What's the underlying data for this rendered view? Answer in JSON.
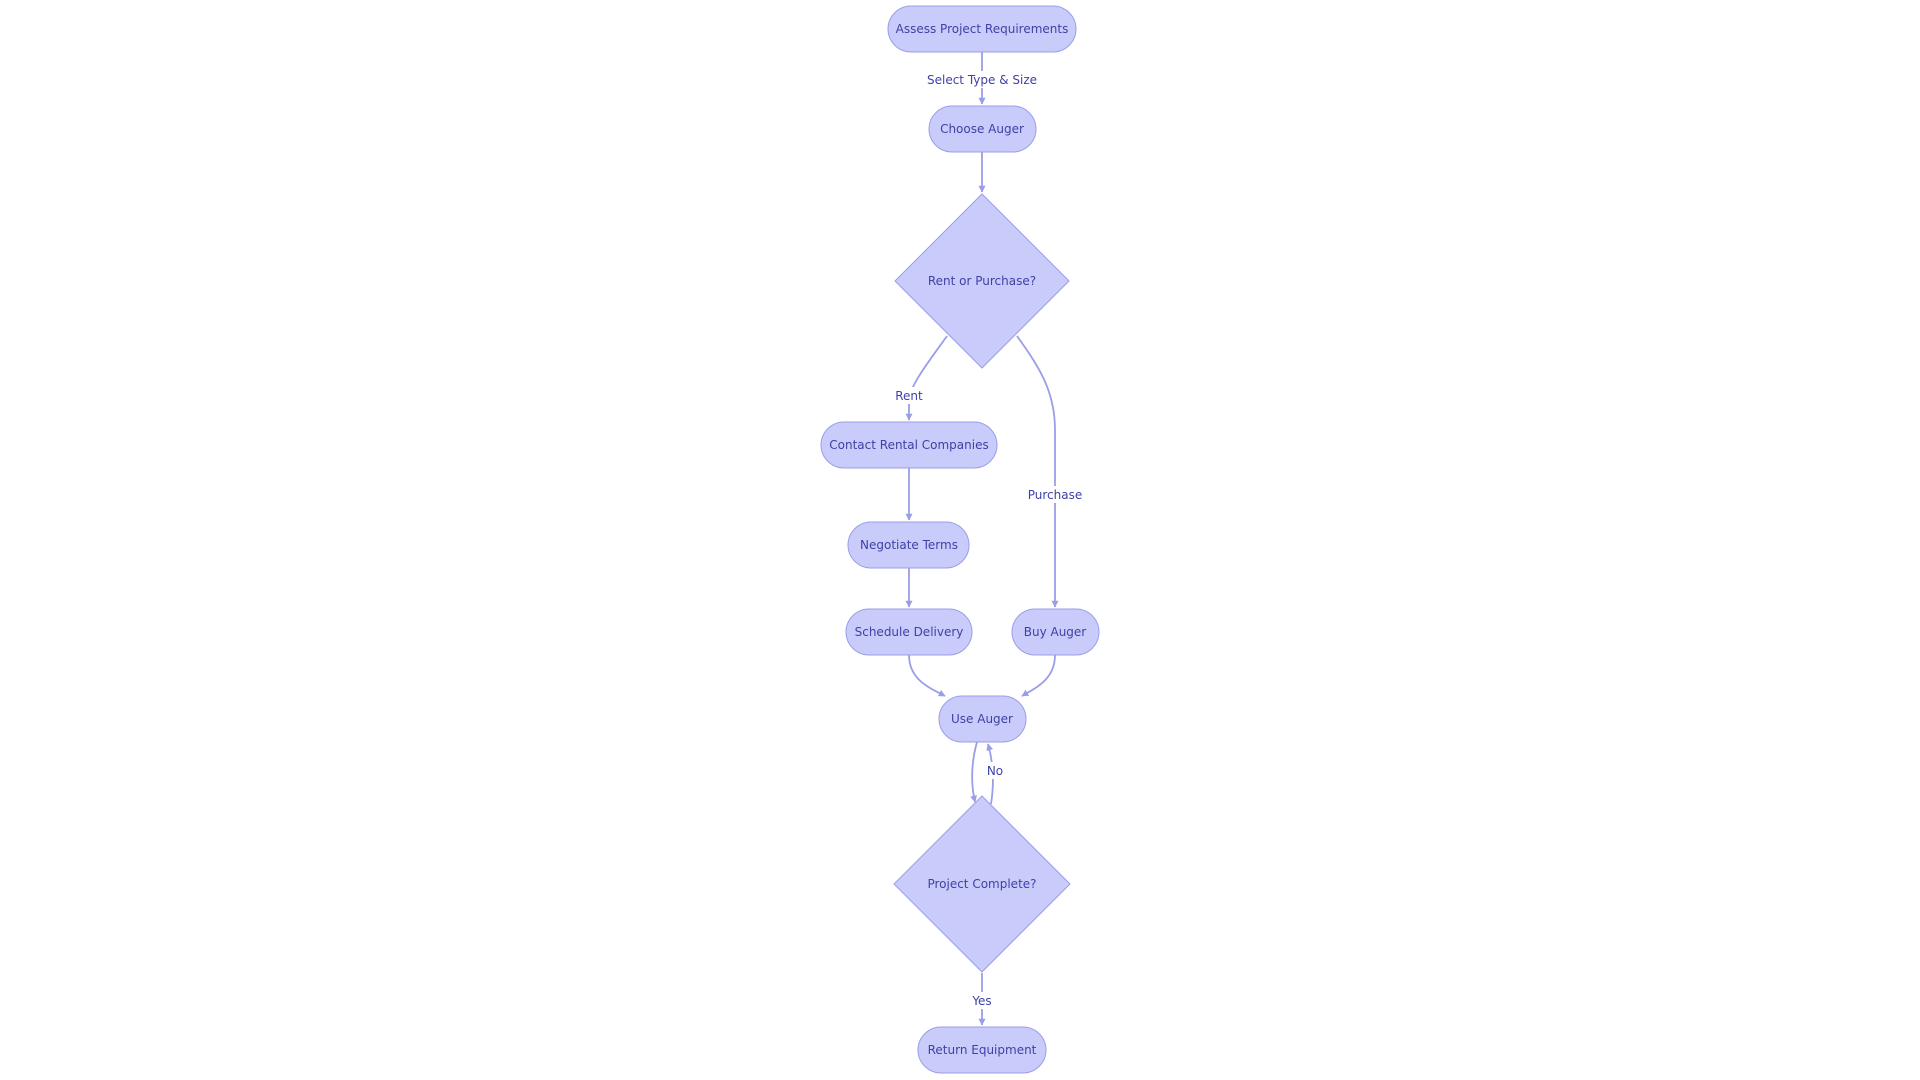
{
  "diagram": {
    "type": "flowchart",
    "colors": {
      "node_fill": "#c9cbfa",
      "node_stroke": "#9a9ee8",
      "edge": "#9a9ee6",
      "text": "#3f41a6",
      "background": "#ffffff"
    },
    "nodes": [
      {
        "id": "assess",
        "label": "Assess Project Requirements",
        "shape": "rounded"
      },
      {
        "id": "choose",
        "label": "Choose Auger",
        "shape": "rounded"
      },
      {
        "id": "rentOrPurchase",
        "label": "Rent or Purchase?",
        "shape": "diamond"
      },
      {
        "id": "contact",
        "label": "Contact Rental Companies",
        "shape": "rounded"
      },
      {
        "id": "negotiate",
        "label": "Negotiate Terms",
        "shape": "rounded"
      },
      {
        "id": "schedule",
        "label": "Schedule Delivery",
        "shape": "rounded"
      },
      {
        "id": "buy",
        "label": "Buy Auger",
        "shape": "rounded"
      },
      {
        "id": "use",
        "label": "Use Auger",
        "shape": "rounded"
      },
      {
        "id": "complete",
        "label": "Project Complete?",
        "shape": "diamond"
      },
      {
        "id": "return",
        "label": "Return Equipment",
        "shape": "rounded"
      }
    ],
    "edges": [
      {
        "from": "assess",
        "to": "choose",
        "label": "Select Type & Size"
      },
      {
        "from": "choose",
        "to": "rentOrPurchase",
        "label": ""
      },
      {
        "from": "rentOrPurchase",
        "to": "contact",
        "label": "Rent"
      },
      {
        "from": "rentOrPurchase",
        "to": "buy",
        "label": "Purchase"
      },
      {
        "from": "contact",
        "to": "negotiate",
        "label": ""
      },
      {
        "from": "negotiate",
        "to": "schedule",
        "label": ""
      },
      {
        "from": "schedule",
        "to": "use",
        "label": ""
      },
      {
        "from": "buy",
        "to": "use",
        "label": ""
      },
      {
        "from": "use",
        "to": "complete",
        "label": ""
      },
      {
        "from": "complete",
        "to": "use",
        "label": "No"
      },
      {
        "from": "complete",
        "to": "return",
        "label": "Yes"
      }
    ]
  }
}
